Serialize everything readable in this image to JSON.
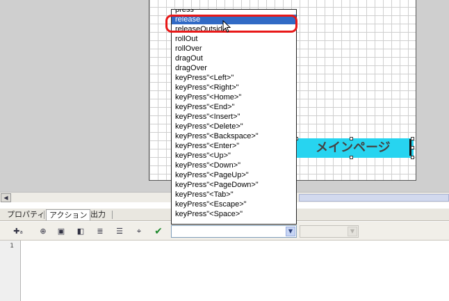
{
  "stage": {
    "button_label": "メインページ"
  },
  "event_list": {
    "items": [
      "press",
      "release",
      "releaseOutside",
      "rollOut",
      "rollOver",
      "dragOut",
      "dragOver",
      "keyPress\"<Left>\"",
      "keyPress\"<Right>\"",
      "keyPress\"<Home>\"",
      "keyPress\"<End>\"",
      "keyPress\"<Insert>\"",
      "keyPress\"<Delete>\"",
      "keyPress\"<Backspace>\"",
      "keyPress\"<Enter>\"",
      "keyPress\"<Up>\"",
      "keyPress\"<Down>\"",
      "keyPress\"<PageUp>\"",
      "keyPress\"<PageDown>\"",
      "keyPress\"<Tab>\"",
      "keyPress\"<Escape>\"",
      "keyPress\"<Space>\""
    ],
    "selected_index": 1,
    "highlight_color": "#e81818",
    "selection_color": "#316ac5"
  },
  "panel_tabs": [
    {
      "label": "プロパティ"
    },
    {
      "label": "アクション"
    },
    {
      "label": "出力"
    }
  ],
  "active_tab_index": 1,
  "toolbar": {
    "icons": [
      "add-statement-icon",
      "insert-target-path-icon",
      "find-icon",
      "replace-icon",
      "check-syntax-icon",
      "auto-format-icon",
      "insert-target-icon",
      "apply-check-icon"
    ]
  },
  "editor": {
    "line_numbers": [
      "1"
    ]
  },
  "colors": {
    "button_fill": "#27d4f0",
    "stage_background": "#cfcfcf"
  }
}
